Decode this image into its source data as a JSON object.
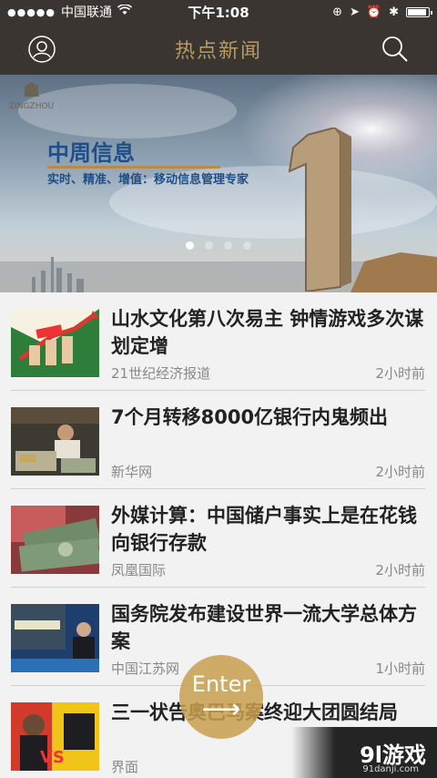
{
  "status": {
    "signal": "●●●●●",
    "carrier": "中国联通",
    "time": "下午1:08"
  },
  "nav": {
    "title": "热点新闻"
  },
  "banner": {
    "title": "中周信息",
    "subtitle": "实时、精准、增值：移动信息管理专家",
    "logo_text": "ZINGZHOU",
    "active_slide": 1,
    "slides": 4
  },
  "news": [
    {
      "title": "山水文化第八次易主 钟情游戏多次谋划定增",
      "source": "21世纪经济报道",
      "time": "2小时前"
    },
    {
      "title": "7个月转移8000亿银行内鬼频出",
      "source": "新华网",
      "time": "2小时前"
    },
    {
      "title": "外媒计算：中国储户事实上是在花钱向银行存款",
      "source": "凤凰国际",
      "time": "2小时前"
    },
    {
      "title": "国务院发布建设世界一流大学总体方案",
      "source": "中国江苏网",
      "time": "1小时前"
    },
    {
      "title": "三一状告奥巴马案终迎大团圆结局",
      "source": "界面",
      "time": ""
    }
  ],
  "enter": {
    "label": "Enter",
    "arrow": "⟶"
  },
  "watermark": {
    "logo": "9l游戏",
    "url": "91danji.com"
  }
}
